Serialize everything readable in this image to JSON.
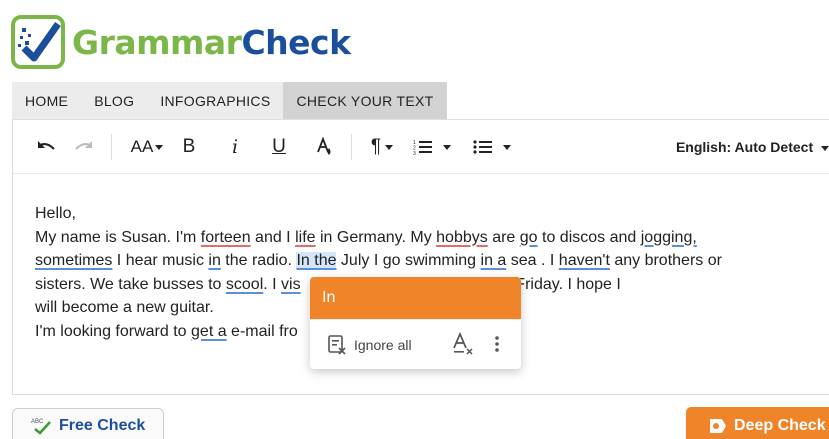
{
  "brand": {
    "name_part1": "Grammar",
    "name_part2": "Check"
  },
  "nav": {
    "items": [
      {
        "label": "HOME"
      },
      {
        "label": "BLOG"
      },
      {
        "label": "INFOGRAPHICS"
      },
      {
        "label": "CHECK YOUR TEXT"
      }
    ]
  },
  "toolbar": {
    "font_size_label": "AA",
    "bold_label": "B",
    "italic_label": "i",
    "underline_label": "U",
    "language": "English: Auto Detect"
  },
  "editor": {
    "line1": "Hello,",
    "line2": {
      "a": "My name is Susan. I'm ",
      "e1": "forteen",
      "b": " and I ",
      "e2": "life",
      "c": " in Germany. My ",
      "e3": "hobbys",
      "d": " are ",
      "e4": "go",
      "e": " to discos and ",
      "e5": "jogging,"
    },
    "line3": {
      "e1": "sometimes",
      "a": " I hear music ",
      "e2": "in",
      "b": " the radio. ",
      "e3": "In the",
      "c": " July I go swimming ",
      "e4": "in a",
      "d": " sea . I ",
      "e5": "haven't",
      "e": " any brothers or"
    },
    "line4": {
      "a": "sisters. We take busses to ",
      "e1": "scool",
      "b": ". I ",
      "e2": "vis",
      "c": "irthday is on Friday. I hope I"
    },
    "line5": "will become a new guitar.",
    "line6": {
      "a": "I'm looking forward to ",
      "e1": "get a",
      "b": " e-mail fro"
    }
  },
  "popup": {
    "suggestion": "In",
    "ignore_label": "Ignore all"
  },
  "buttons": {
    "free_check": "Free Check",
    "deep_check": "Deep Check"
  },
  "colors": {
    "brand_green": "#7ab648",
    "brand_blue": "#1b4f9c",
    "accent_orange": "#f08428",
    "error_red": "#e06c6c",
    "error_blue": "#5b8fd6"
  }
}
